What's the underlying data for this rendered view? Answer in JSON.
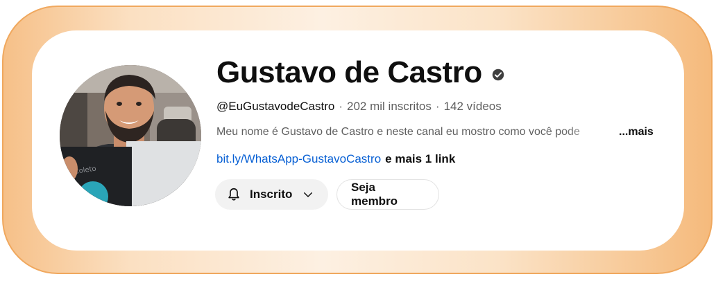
{
  "channel": {
    "name": "Gustavo de Castro",
    "verified_icon": "verified-check-icon",
    "handle": "@EuGustavodeCastro",
    "separator": "·",
    "subscribers": "202 mil inscritos",
    "videos": "142 vídeos",
    "description": "Meu nome é Gustavo de Castro e neste canal eu mostro como você pode",
    "more_label": "...mais",
    "link_text": "bit.ly/WhatsApp-GustavoCastro",
    "more_links": "e mais 1 link"
  },
  "buttons": {
    "subscribed_label": "Inscrito",
    "subscribed_icon": "bell-icon",
    "dropdown_icon": "chevron-down-icon",
    "join_label": "Seja membro"
  },
  "colors": {
    "frame_gradient_edge": "#f5ba7c",
    "frame_gradient_center": "#fdf0e2",
    "link": "#065fd4",
    "text_primary": "#0f0f0f",
    "text_secondary": "#606060",
    "button_bg": "#f2f2f2"
  }
}
